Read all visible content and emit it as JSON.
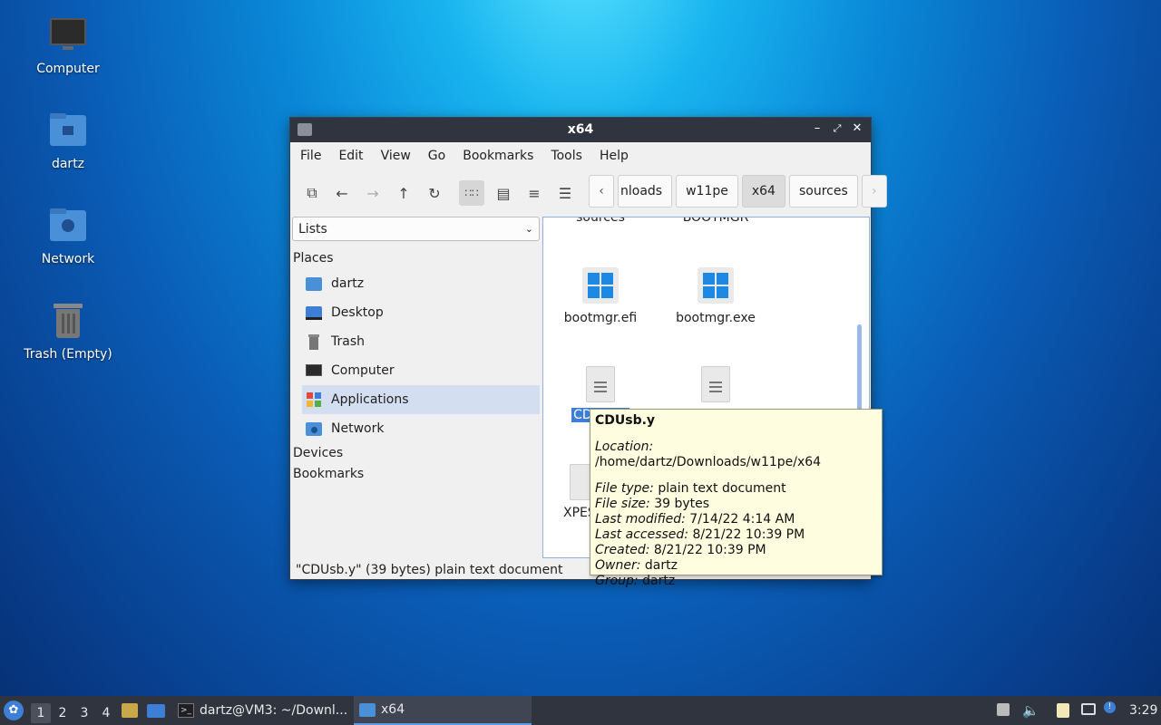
{
  "desktop": {
    "icons": [
      {
        "label": "Computer"
      },
      {
        "label": "dartz"
      },
      {
        "label": "Network"
      },
      {
        "label": "Trash (Empty)"
      }
    ]
  },
  "window": {
    "title": "x64",
    "menu": [
      "File",
      "Edit",
      "View",
      "Go",
      "Bookmarks",
      "Tools",
      "Help"
    ],
    "path": [
      "nloads",
      "w11pe",
      "x64",
      "sources"
    ],
    "side": {
      "dropdown": "Lists",
      "places_header": "Places",
      "places": [
        "dartz",
        "Desktop",
        "Trash",
        "Computer",
        "Applications",
        "Network"
      ],
      "devices_header": "Devices",
      "bookmarks_header": "Bookmarks"
    },
    "files": [
      {
        "name": "sources",
        "icon": "folder-icon"
      },
      {
        "name": "BOOTMGR",
        "icon": "file-icon"
      },
      {
        "name": "bootmgr.efi",
        "icon": "windows-icon"
      },
      {
        "name": "bootmgr.exe",
        "icon": "windows-icon"
      },
      {
        "name": "CDUsb.y",
        "icon": "text-file-icon"
      },
      {
        "name": "",
        "icon": "text-file-icon"
      },
      {
        "name": "XPESU",
        "icon": "text-file-icon"
      }
    ],
    "status": "\"CDUsb.y\" (39 bytes) plain text document"
  },
  "tooltip": {
    "name": "CDUsb.y",
    "location_label": "Location:",
    "location": " /home/dartz/Downloads/w11pe/x64",
    "filetype_label": "File type:",
    "filetype": " plain text document",
    "filesize_label": "File size:",
    "filesize": " 39 bytes",
    "modified_label": "Last modified:",
    "modified": " 7/14/22 4:14 AM",
    "accessed_label": "Last accessed:",
    "accessed": " 8/21/22 10:39 PM",
    "created_label": "Created:",
    "created": " 8/21/22 10:39 PM",
    "owner_label": "Owner:",
    "owner": " dartz",
    "group_label": "Group:",
    "group": " dartz"
  },
  "taskbar": {
    "workspaces": [
      "1",
      "2",
      "3",
      "4"
    ],
    "tasks": [
      "dartz@VM3: ~/Downl...",
      "x64"
    ],
    "clock": "3:29"
  },
  "colors": {
    "accent": "#3d7fd6",
    "titlebar": "#2f343f",
    "tooltip_bg": "#fffde0"
  }
}
